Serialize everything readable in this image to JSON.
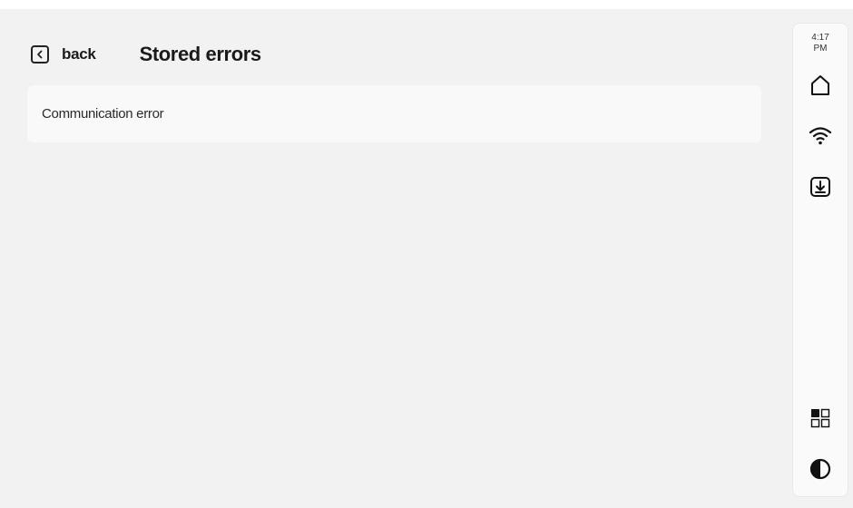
{
  "header": {
    "back_label": "back",
    "title": "Stored errors"
  },
  "errors": [
    {
      "message": "Communication error"
    }
  ],
  "status_bar": {
    "time": "4:17",
    "meridiem": "PM"
  },
  "icons": {
    "back": "chevron-left-icon",
    "home": "home-icon",
    "wifi": "wifi-icon",
    "download": "download-icon",
    "apps": "grid-icon",
    "contrast": "contrast-icon"
  }
}
